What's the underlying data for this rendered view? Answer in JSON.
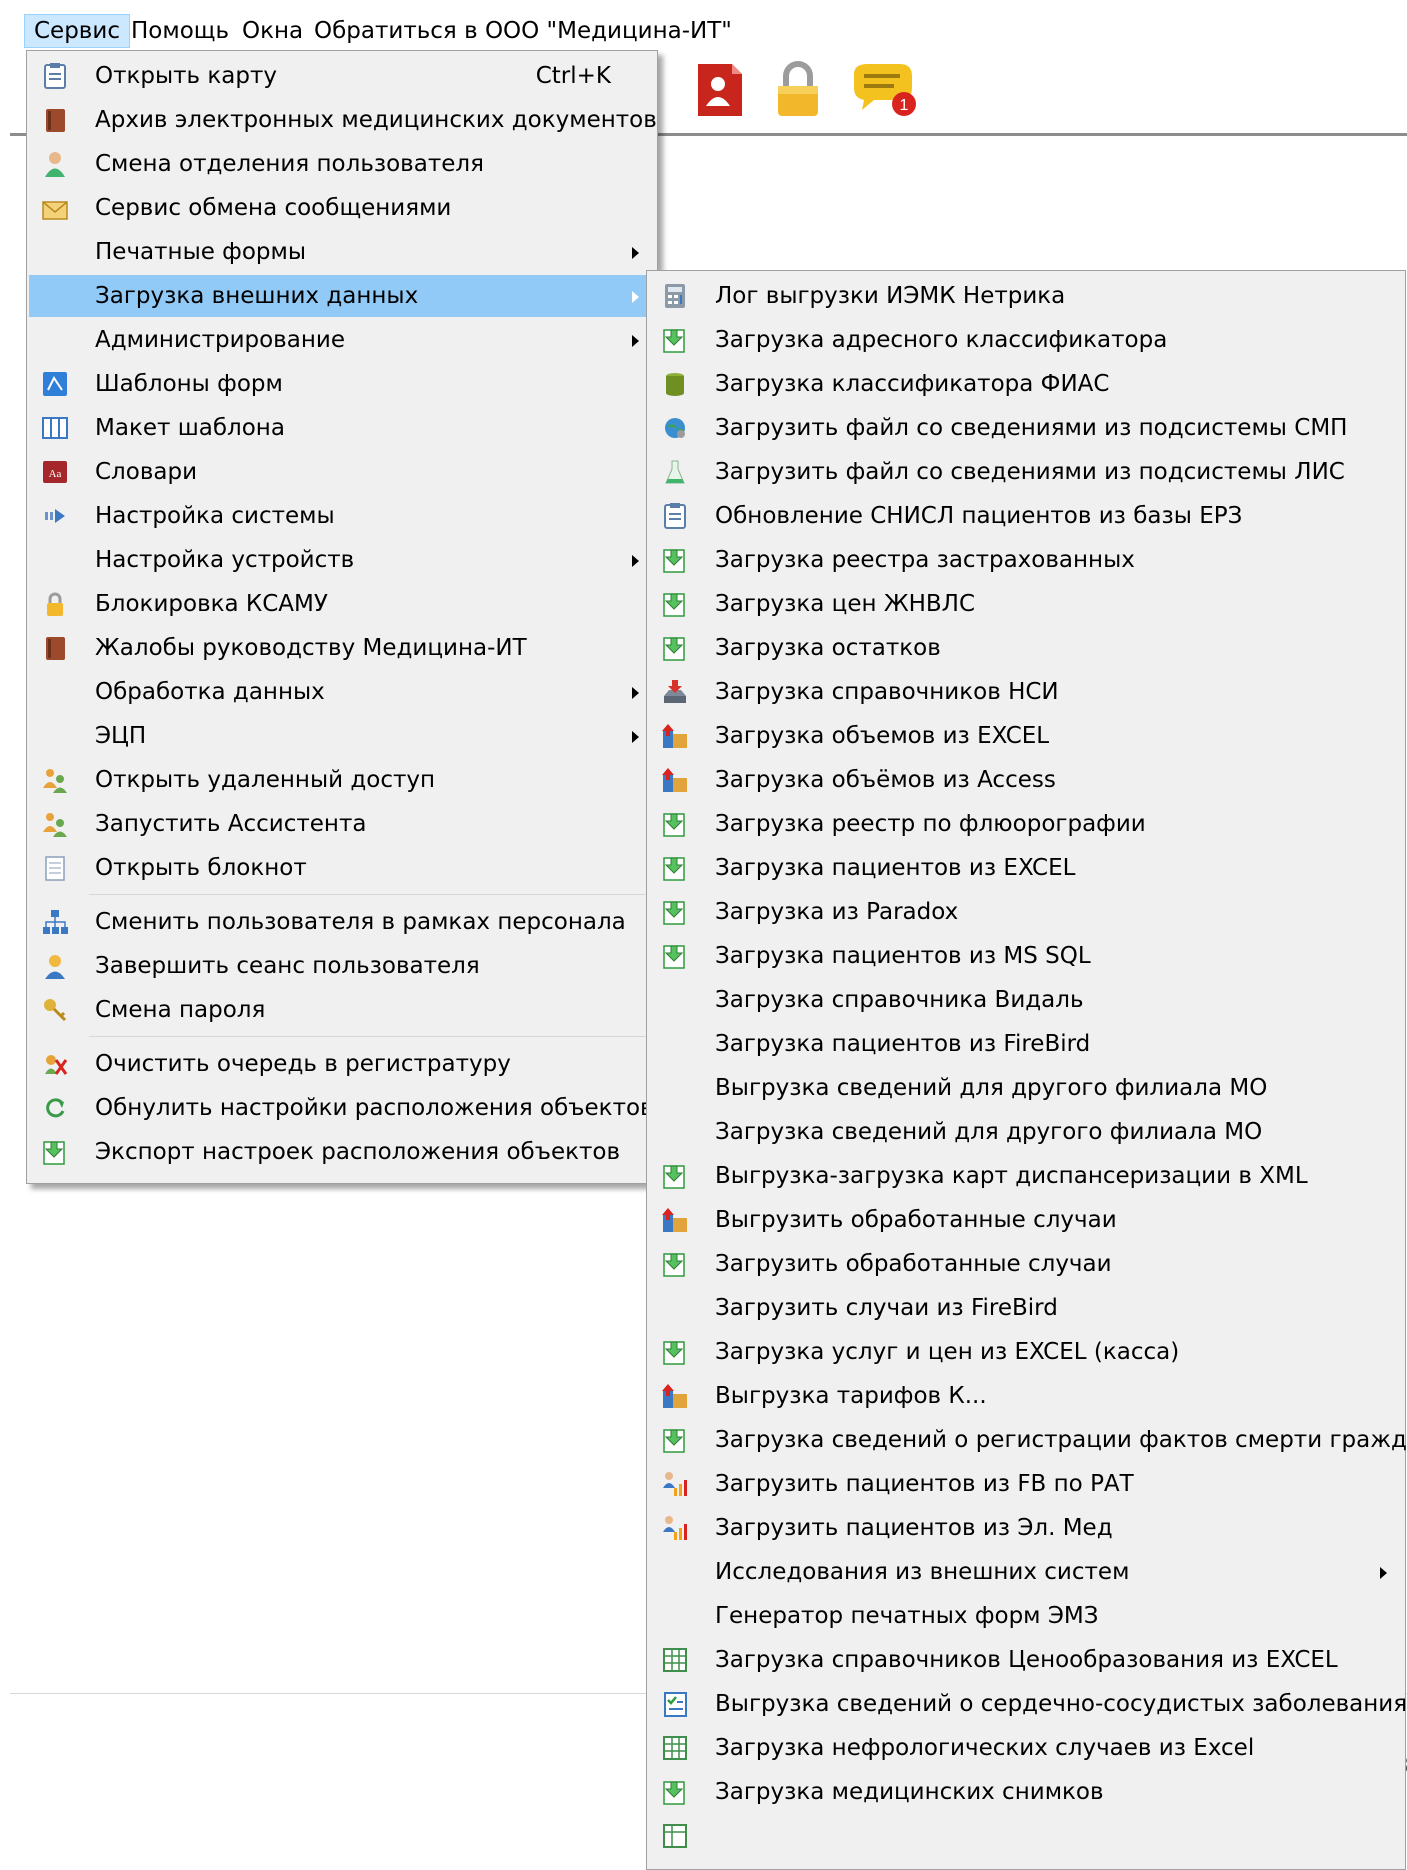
{
  "menubar": {
    "items": [
      {
        "label": "Сервис"
      },
      {
        "label": "Помощь"
      },
      {
        "label": "Окна"
      },
      {
        "label": "Обратиться в ООО \"Медицина-ИТ\""
      }
    ]
  },
  "toolbar": {
    "icons": [
      "tool-icon",
      "pdf-user-icon",
      "lock-icon",
      "chat-notification-icon"
    ],
    "notification_badge": "1"
  },
  "service_menu": {
    "items": [
      {
        "label": "Открыть карту",
        "shortcut": "Ctrl+K",
        "icon": "card-icon"
      },
      {
        "label": "Архив электронных медицинских документов",
        "icon": "archive-book-icon"
      },
      {
        "label": "Смена отделения пользователя",
        "icon": "doctor-icon"
      },
      {
        "label": "Сервис обмена сообщениями",
        "icon": "envelope-icon"
      },
      {
        "label": "Печатные формы",
        "submenu": true
      },
      {
        "label": "Загрузка внешних данных",
        "submenu": true,
        "highlighted": true
      },
      {
        "label": "Администрирование",
        "submenu": true
      },
      {
        "label": "Шаблоны форм",
        "icon": "template-icon"
      },
      {
        "label": "Макет шаблона",
        "icon": "grid-layout-icon"
      },
      {
        "label": "Словари",
        "icon": "dictionary-icon"
      },
      {
        "label": "Настройка системы",
        "icon": "settings-arrow-icon"
      },
      {
        "label": "Настройка устройств",
        "submenu": true
      },
      {
        "label": "Блокировка КСАМУ",
        "icon": "lock-icon"
      },
      {
        "label": "Жалобы руководству Медицина-ИТ",
        "icon": "complaint-book-icon"
      },
      {
        "label": "Обработка данных",
        "submenu": true
      },
      {
        "label": "ЭЦП",
        "submenu": true
      },
      {
        "label": "Открыть удаленный доступ",
        "icon": "remote-users-icon"
      },
      {
        "label": "Запустить Ассистента",
        "icon": "assistant-users-icon"
      },
      {
        "label": "Открыть блокнот",
        "icon": "notepad-icon"
      },
      {
        "label": "Сменить пользователя в рамках персонала",
        "icon": "org-chart-icon"
      },
      {
        "label": "Завершить сеанс пользователя",
        "icon": "user-logout-icon"
      },
      {
        "label": "Смена пароля",
        "icon": "key-icon"
      },
      {
        "label": "Очистить очередь в регистратуру",
        "icon": "clear-queue-icon"
      },
      {
        "label": "Обнулить настройки расположения объектов",
        "icon": "reset-icon"
      },
      {
        "label": "Экспорт настроек расположения объектов",
        "icon": "download-doc-icon"
      }
    ]
  },
  "external_data_submenu": {
    "items": [
      {
        "label": "Лог выгрузки ИЭМК Нетрика",
        "icon": "calculator-icon"
      },
      {
        "label": "Загрузка адресного классификатора",
        "icon": "download-doc-icon"
      },
      {
        "label": "Загрузка классификатора ФИАС",
        "icon": "database-icon"
      },
      {
        "label": "Загрузить файл со сведениями из подсистемы СМП",
        "icon": "globe-gear-icon"
      },
      {
        "label": "Загрузить файл со сведениями из подсистемы ЛИС",
        "icon": "flask-icon"
      },
      {
        "label": "Обновление СНИСЛ пациентов из базы ЕРЗ",
        "icon": "card-icon"
      },
      {
        "label": "Загрузка реестра застрахованных",
        "icon": "download-doc-icon"
      },
      {
        "label": "Загрузка цен ЖНВЛС",
        "icon": "download-doc-icon"
      },
      {
        "label": "Загрузка остатков",
        "icon": "download-doc-icon"
      },
      {
        "label": "Загрузка справочников НСИ",
        "icon": "inbox-download-icon"
      },
      {
        "label": "Загрузка объемов из EXCEL",
        "icon": "package-upload-icon"
      },
      {
        "label": "Загрузка объёмов из Access",
        "icon": "package-upload-icon"
      },
      {
        "label": "Загрузка реестр по флюорографии",
        "icon": "download-doc-icon"
      },
      {
        "label": "Загрузка пациентов из EXCEL",
        "icon": "download-doc-icon"
      },
      {
        "label": "Загрузка из Paradox",
        "icon": "download-doc-icon"
      },
      {
        "label": "Загрузка пациентов из MS SQL",
        "icon": "download-doc-icon"
      },
      {
        "label": "Загрузка справочника Видаль"
      },
      {
        "label": "Загрузка пациентов из FireBird"
      },
      {
        "label": "Выгрузка сведений для другого филиала МО"
      },
      {
        "label": "Загрузка сведений для другого филиала МО"
      },
      {
        "label": "Выгрузка-загрузка карт диспансеризации в XML",
        "icon": "download-doc-icon"
      },
      {
        "label": "Выгрузить обработанные случаи",
        "icon": "package-upload-icon"
      },
      {
        "label": "Загрузить обработанные случаи",
        "icon": "download-doc-icon"
      },
      {
        "label": "Загрузить случаи из FireBird"
      },
      {
        "label": "Загрузка услуг и цен из EXCEL (касса)",
        "icon": "download-doc-icon"
      },
      {
        "label": "Выгрузка тарифов К...",
        "icon": "package-upload-icon"
      },
      {
        "label": "Загрузка сведений о регистрации фактов смерти граждан",
        "icon": "download-doc-icon"
      },
      {
        "label": "Загрузить пациентов из FB по РАТ",
        "icon": "user-chart-icon"
      },
      {
        "label": "Загрузить пациентов из Эл. Мед",
        "icon": "user-chart-icon"
      },
      {
        "label": "Исследования из внешних систем",
        "submenu": true
      },
      {
        "label": "Генератор печатных форм ЭМЗ"
      },
      {
        "label": "Загрузка справочников Ценообразования  из EXCEL",
        "icon": "spreadsheet-icon"
      },
      {
        "label": "Выгрузка сведений о сердечно-сосудистых заболеваниях",
        "icon": "checklist-icon"
      },
      {
        "label": "Загрузка нефрологических случаев из Excel",
        "icon": "spreadsheet-icon"
      },
      {
        "label": "Загрузка медицинских снимков",
        "icon": "download-doc-icon"
      },
      {
        "label": "",
        "icon": "spreadsheet-icon"
      }
    ]
  },
  "edge_glyph": "3",
  "colors": {
    "menu_background": "#f0f0f0",
    "highlight": "#91c9f7",
    "menubar_active": "#cce8ff",
    "separator": "#d7d7d7"
  }
}
